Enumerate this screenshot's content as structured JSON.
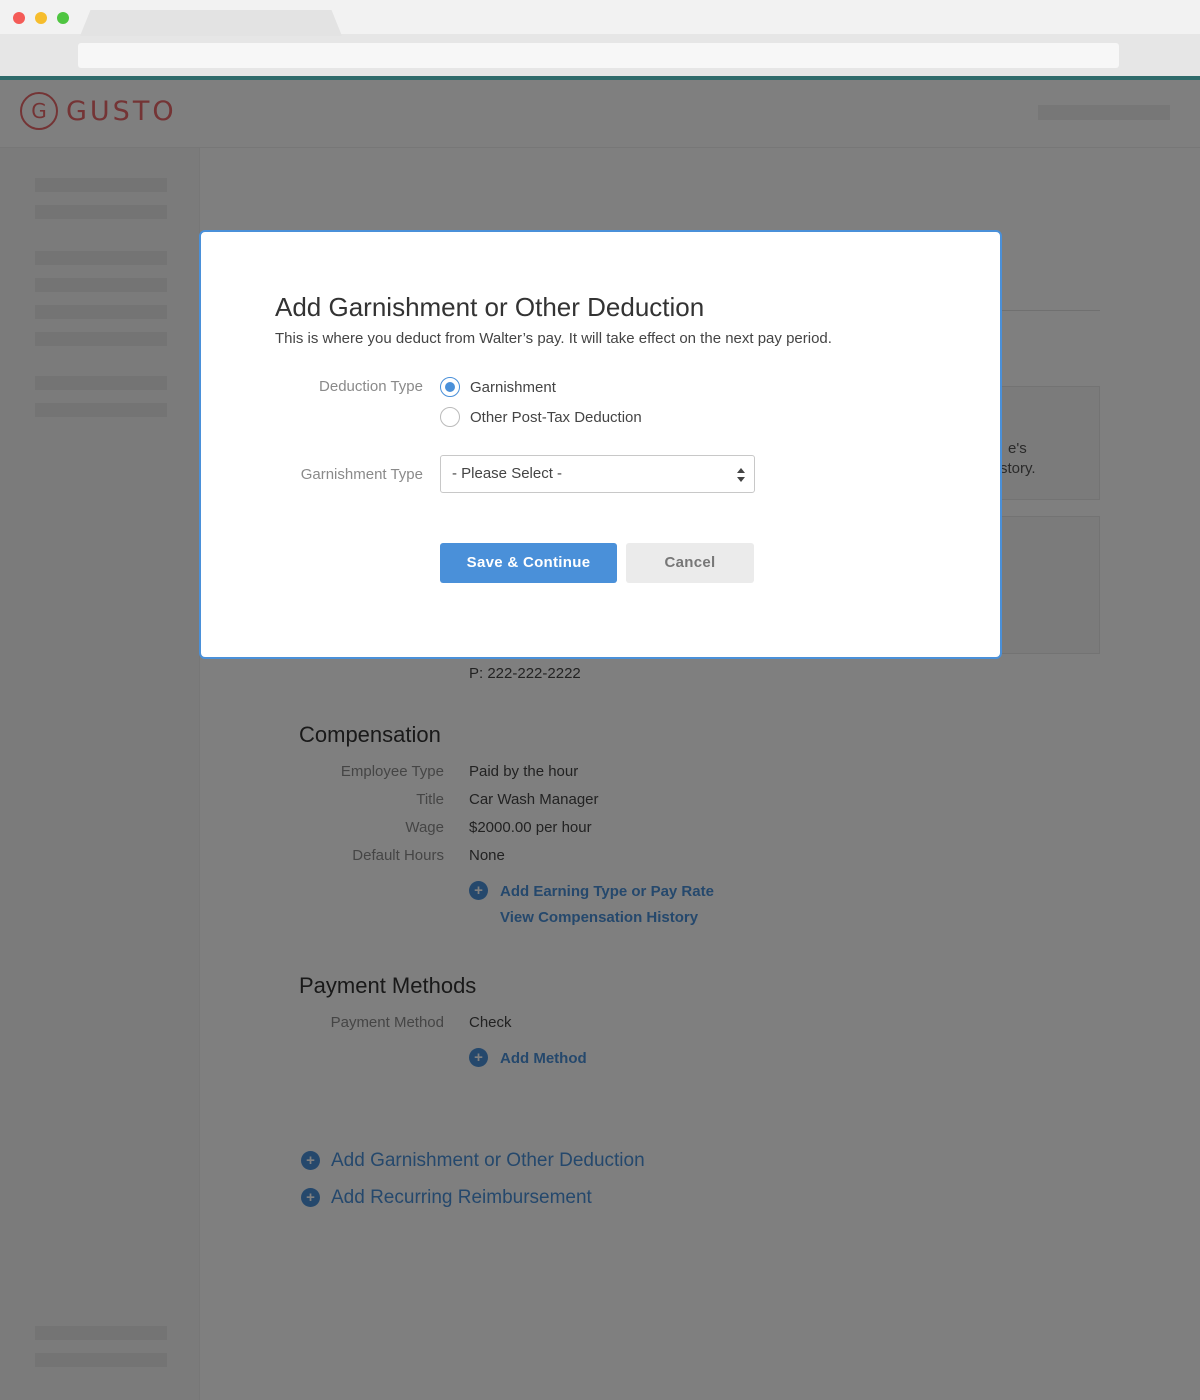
{
  "app": {
    "logo_text": "GUSTO"
  },
  "background": {
    "peek_line_1": "e's",
    "peek_line_2": "story.",
    "phone": "P: 222-222-2222",
    "compensation": {
      "title": "Compensation",
      "rows": [
        {
          "label": "Employee Type",
          "value": "Paid by the hour"
        },
        {
          "label": "Title",
          "value": "Car Wash Manager"
        },
        {
          "label": "Wage",
          "value": "$2000.00 per hour"
        },
        {
          "label": "Default Hours",
          "value": "None"
        }
      ],
      "add_earning_link": "Add Earning Type or Pay Rate",
      "view_history_link": "View Compensation History"
    },
    "payment_methods": {
      "title": "Payment Methods",
      "rows": [
        {
          "label": "Payment Method",
          "value": "Check"
        }
      ],
      "add_method_link": "Add Method"
    },
    "add_garnishment_link": "Add Garnishment or Other Deduction",
    "add_reimbursement_link": "Add Recurring Reimbursement"
  },
  "modal": {
    "title": "Add Garnishment or Other Deduction",
    "subtitle": "This is where you deduct from Walter’s pay. It will take effect on the next pay period.",
    "deduction_type_label": "Deduction Type",
    "deduction_options": [
      {
        "label": "Garnishment",
        "checked": true
      },
      {
        "label": "Other Post-Tax Deduction",
        "checked": false
      }
    ],
    "garnishment_type_label": "Garnishment Type",
    "garnishment_select_value": "- Please Select -",
    "save_button": "Save & Continue",
    "cancel_button": "Cancel"
  },
  "colors": {
    "accent": "#4a90d9",
    "brand": "#e8686a",
    "overlay": "rgba(0,0,0,0.5)"
  }
}
